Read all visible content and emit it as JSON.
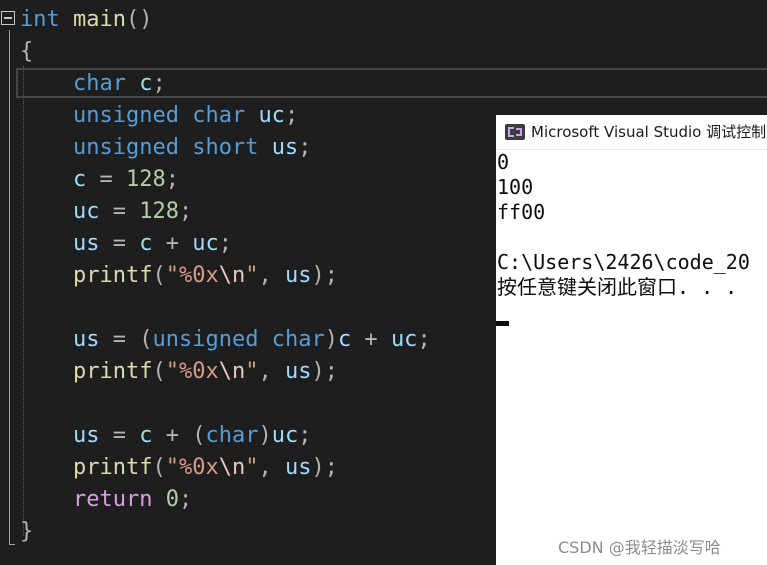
{
  "editor": {
    "lines": {
      "l0": {
        "kw_int": "int",
        "fn_main": "main",
        "parens": "()"
      },
      "l1": {
        "brace": "{"
      },
      "l2": {
        "kw_char": "char",
        "var_c": "c",
        "semi": ";"
      },
      "l3": {
        "kw_unsigned": "unsigned",
        "kw_char": "char",
        "var_uc": "uc",
        "semi": ";"
      },
      "l4": {
        "kw_unsigned": "unsigned",
        "kw_short": "short",
        "var_us": "us",
        "semi": ";"
      },
      "l5": {
        "var_c": "c",
        "op": " = ",
        "num": "128",
        "semi": ";"
      },
      "l6": {
        "var_uc": "uc",
        "op": " = ",
        "num": "128",
        "semi": ";"
      },
      "l7": {
        "var_us": "us",
        "op": " = ",
        "var_c": "c",
        "plus": " + ",
        "var_uc": "uc",
        "semi": ";"
      },
      "l8": {
        "fn": "printf",
        "open": "(",
        "str_a": "\"%0x",
        "esc": "\\n",
        "str_b": "\"",
        "comma": ", ",
        "var_us": "us",
        "close": ");"
      },
      "l10": {
        "var_us": "us",
        "op": " = ",
        "open": "(",
        "kw_unsigned": "unsigned",
        "kw_char": "char",
        "close": ")",
        "var_c": "c",
        "plus": " + ",
        "var_uc": "uc",
        "semi": ";"
      },
      "l11": {
        "fn": "printf",
        "open": "(",
        "str_a": "\"%0x",
        "esc": "\\n",
        "str_b": "\"",
        "comma": ", ",
        "var_us": "us",
        "close": ");"
      },
      "l13": {
        "var_us": "us",
        "op": " = ",
        "var_c": "c",
        "plus": " + ",
        "open": "(",
        "kw_char": "char",
        "close": ")",
        "var_uc": "uc",
        "semi": ";"
      },
      "l14": {
        "fn": "printf",
        "open": "(",
        "str_a": "\"%0x",
        "esc": "\\n",
        "str_b": "\"",
        "comma": ", ",
        "var_us": "us",
        "close": ");"
      },
      "l15": {
        "kw_return": "return",
        "num": "0",
        "semi": ";"
      },
      "l16": {
        "brace": "}"
      }
    }
  },
  "console": {
    "title": "Microsoft Visual Studio 调试控制台",
    "output": [
      "0",
      "100",
      "ff00",
      "",
      "C:\\Users\\2426\\code_20",
      "按任意键关闭此窗口. . ."
    ]
  },
  "watermark": "CSDN @我轻描淡写哈",
  "colors": {
    "editor_bg": "#1e1e1e",
    "keyword": "#569cd6",
    "function": "#dcdcaa",
    "variable": "#9cdcfe",
    "number": "#b5cea8",
    "string": "#d69d85",
    "control": "#d8a0df",
    "console_bg": "#ffffff"
  }
}
